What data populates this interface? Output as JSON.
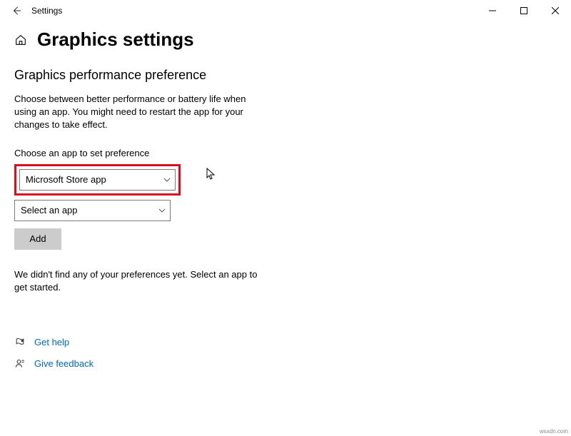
{
  "window": {
    "title": "Settings"
  },
  "page": {
    "title": "Graphics settings"
  },
  "section": {
    "title": "Graphics performance preference",
    "description": "Choose between better performance or battery life when using an app. You might need to restart the app for your changes to take effect.",
    "choose_label": "Choose an app to set preference",
    "app_type_selected": "Microsoft Store app",
    "app_selected": "Select an app",
    "add_label": "Add",
    "empty_message": "We didn't find any of your preferences yet. Select an app to get started."
  },
  "links": {
    "help": "Get help",
    "feedback": "Give feedback"
  },
  "watermark": "wsxdn.com"
}
